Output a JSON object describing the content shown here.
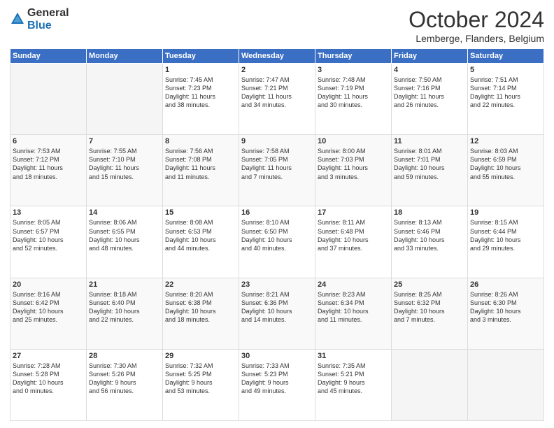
{
  "logo": {
    "general": "General",
    "blue": "Blue"
  },
  "title": "October 2024",
  "location": "Lemberge, Flanders, Belgium",
  "days": [
    "Sunday",
    "Monday",
    "Tuesday",
    "Wednesday",
    "Thursday",
    "Friday",
    "Saturday"
  ],
  "weeks": [
    [
      {
        "num": "",
        "lines": []
      },
      {
        "num": "",
        "lines": []
      },
      {
        "num": "1",
        "lines": [
          "Sunrise: 7:45 AM",
          "Sunset: 7:23 PM",
          "Daylight: 11 hours",
          "and 38 minutes."
        ]
      },
      {
        "num": "2",
        "lines": [
          "Sunrise: 7:47 AM",
          "Sunset: 7:21 PM",
          "Daylight: 11 hours",
          "and 34 minutes."
        ]
      },
      {
        "num": "3",
        "lines": [
          "Sunrise: 7:48 AM",
          "Sunset: 7:19 PM",
          "Daylight: 11 hours",
          "and 30 minutes."
        ]
      },
      {
        "num": "4",
        "lines": [
          "Sunrise: 7:50 AM",
          "Sunset: 7:16 PM",
          "Daylight: 11 hours",
          "and 26 minutes."
        ]
      },
      {
        "num": "5",
        "lines": [
          "Sunrise: 7:51 AM",
          "Sunset: 7:14 PM",
          "Daylight: 11 hours",
          "and 22 minutes."
        ]
      }
    ],
    [
      {
        "num": "6",
        "lines": [
          "Sunrise: 7:53 AM",
          "Sunset: 7:12 PM",
          "Daylight: 11 hours",
          "and 18 minutes."
        ]
      },
      {
        "num": "7",
        "lines": [
          "Sunrise: 7:55 AM",
          "Sunset: 7:10 PM",
          "Daylight: 11 hours",
          "and 15 minutes."
        ]
      },
      {
        "num": "8",
        "lines": [
          "Sunrise: 7:56 AM",
          "Sunset: 7:08 PM",
          "Daylight: 11 hours",
          "and 11 minutes."
        ]
      },
      {
        "num": "9",
        "lines": [
          "Sunrise: 7:58 AM",
          "Sunset: 7:05 PM",
          "Daylight: 11 hours",
          "and 7 minutes."
        ]
      },
      {
        "num": "10",
        "lines": [
          "Sunrise: 8:00 AM",
          "Sunset: 7:03 PM",
          "Daylight: 11 hours",
          "and 3 minutes."
        ]
      },
      {
        "num": "11",
        "lines": [
          "Sunrise: 8:01 AM",
          "Sunset: 7:01 PM",
          "Daylight: 10 hours",
          "and 59 minutes."
        ]
      },
      {
        "num": "12",
        "lines": [
          "Sunrise: 8:03 AM",
          "Sunset: 6:59 PM",
          "Daylight: 10 hours",
          "and 55 minutes."
        ]
      }
    ],
    [
      {
        "num": "13",
        "lines": [
          "Sunrise: 8:05 AM",
          "Sunset: 6:57 PM",
          "Daylight: 10 hours",
          "and 52 minutes."
        ]
      },
      {
        "num": "14",
        "lines": [
          "Sunrise: 8:06 AM",
          "Sunset: 6:55 PM",
          "Daylight: 10 hours",
          "and 48 minutes."
        ]
      },
      {
        "num": "15",
        "lines": [
          "Sunrise: 8:08 AM",
          "Sunset: 6:53 PM",
          "Daylight: 10 hours",
          "and 44 minutes."
        ]
      },
      {
        "num": "16",
        "lines": [
          "Sunrise: 8:10 AM",
          "Sunset: 6:50 PM",
          "Daylight: 10 hours",
          "and 40 minutes."
        ]
      },
      {
        "num": "17",
        "lines": [
          "Sunrise: 8:11 AM",
          "Sunset: 6:48 PM",
          "Daylight: 10 hours",
          "and 37 minutes."
        ]
      },
      {
        "num": "18",
        "lines": [
          "Sunrise: 8:13 AM",
          "Sunset: 6:46 PM",
          "Daylight: 10 hours",
          "and 33 minutes."
        ]
      },
      {
        "num": "19",
        "lines": [
          "Sunrise: 8:15 AM",
          "Sunset: 6:44 PM",
          "Daylight: 10 hours",
          "and 29 minutes."
        ]
      }
    ],
    [
      {
        "num": "20",
        "lines": [
          "Sunrise: 8:16 AM",
          "Sunset: 6:42 PM",
          "Daylight: 10 hours",
          "and 25 minutes."
        ]
      },
      {
        "num": "21",
        "lines": [
          "Sunrise: 8:18 AM",
          "Sunset: 6:40 PM",
          "Daylight: 10 hours",
          "and 22 minutes."
        ]
      },
      {
        "num": "22",
        "lines": [
          "Sunrise: 8:20 AM",
          "Sunset: 6:38 PM",
          "Daylight: 10 hours",
          "and 18 minutes."
        ]
      },
      {
        "num": "23",
        "lines": [
          "Sunrise: 8:21 AM",
          "Sunset: 6:36 PM",
          "Daylight: 10 hours",
          "and 14 minutes."
        ]
      },
      {
        "num": "24",
        "lines": [
          "Sunrise: 8:23 AM",
          "Sunset: 6:34 PM",
          "Daylight: 10 hours",
          "and 11 minutes."
        ]
      },
      {
        "num": "25",
        "lines": [
          "Sunrise: 8:25 AM",
          "Sunset: 6:32 PM",
          "Daylight: 10 hours",
          "and 7 minutes."
        ]
      },
      {
        "num": "26",
        "lines": [
          "Sunrise: 8:26 AM",
          "Sunset: 6:30 PM",
          "Daylight: 10 hours",
          "and 3 minutes."
        ]
      }
    ],
    [
      {
        "num": "27",
        "lines": [
          "Sunrise: 7:28 AM",
          "Sunset: 5:28 PM",
          "Daylight: 10 hours",
          "and 0 minutes."
        ]
      },
      {
        "num": "28",
        "lines": [
          "Sunrise: 7:30 AM",
          "Sunset: 5:26 PM",
          "Daylight: 9 hours",
          "and 56 minutes."
        ]
      },
      {
        "num": "29",
        "lines": [
          "Sunrise: 7:32 AM",
          "Sunset: 5:25 PM",
          "Daylight: 9 hours",
          "and 53 minutes."
        ]
      },
      {
        "num": "30",
        "lines": [
          "Sunrise: 7:33 AM",
          "Sunset: 5:23 PM",
          "Daylight: 9 hours",
          "and 49 minutes."
        ]
      },
      {
        "num": "31",
        "lines": [
          "Sunrise: 7:35 AM",
          "Sunset: 5:21 PM",
          "Daylight: 9 hours",
          "and 45 minutes."
        ]
      },
      {
        "num": "",
        "lines": []
      },
      {
        "num": "",
        "lines": []
      }
    ]
  ]
}
